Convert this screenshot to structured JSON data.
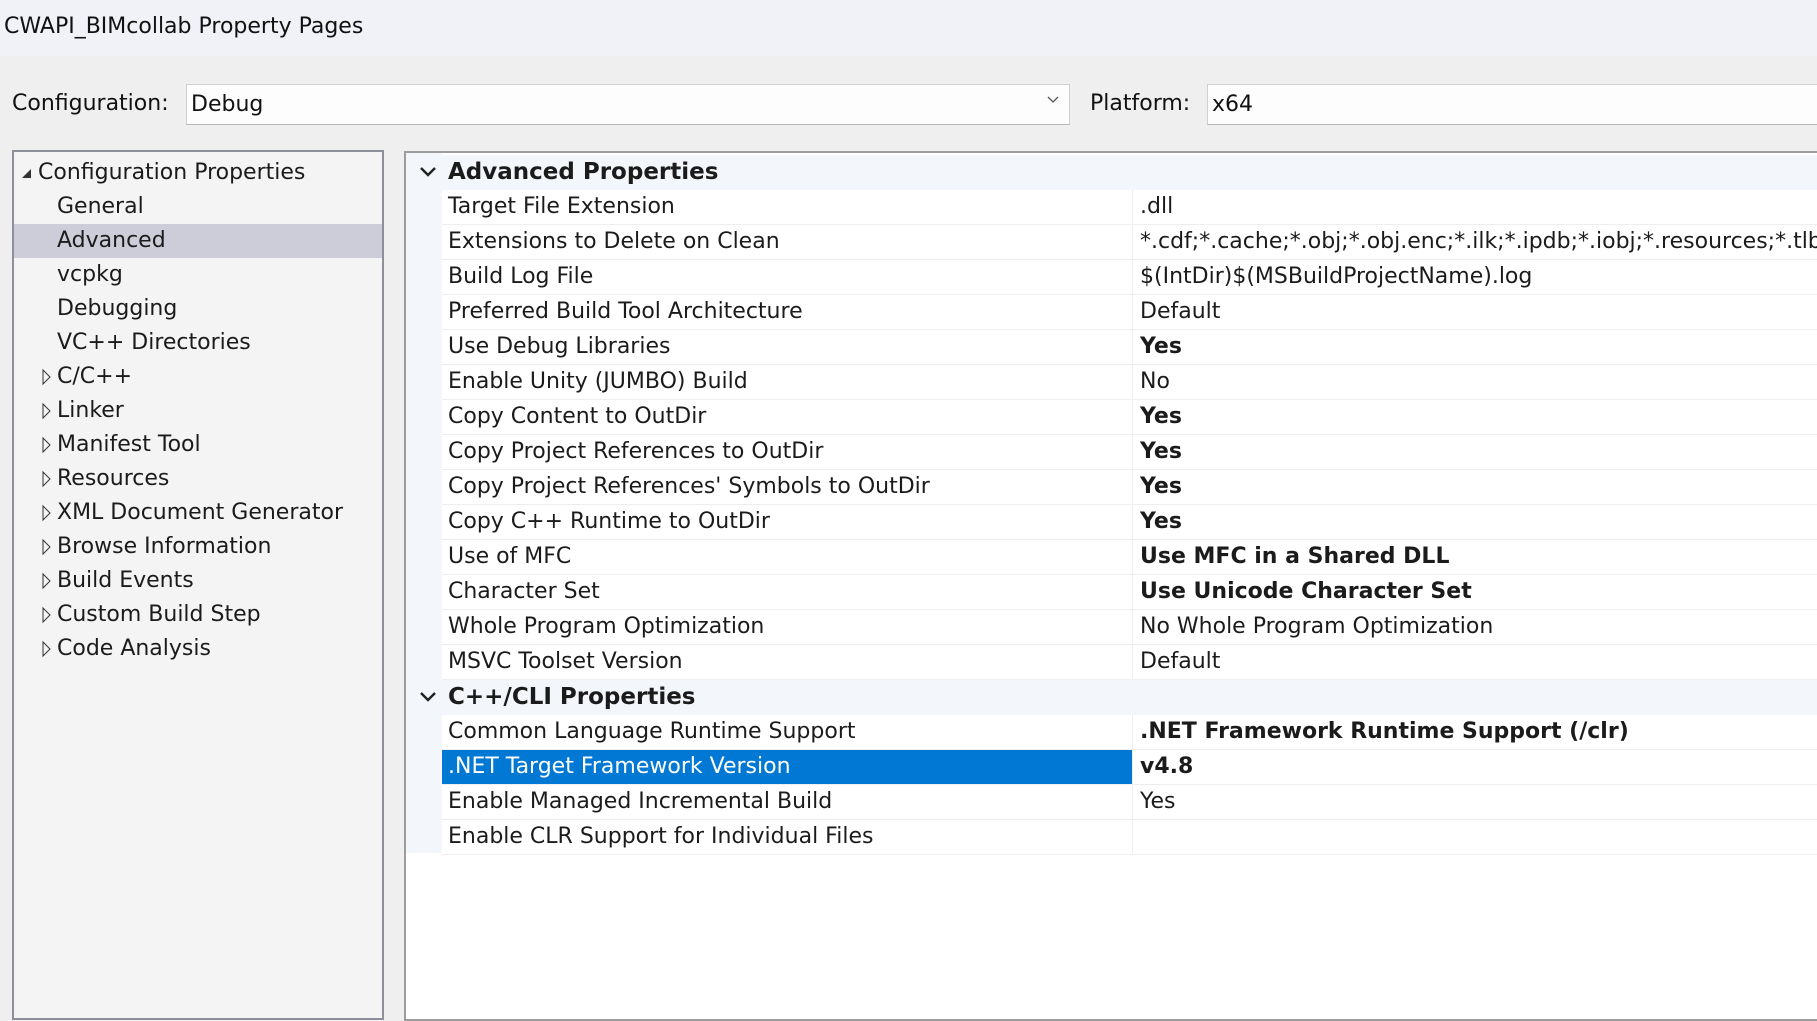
{
  "window": {
    "title": "CWAPI_BIMcollab Property Pages"
  },
  "config_bar": {
    "configuration_label": "Configuration:",
    "configuration_value": "Debug",
    "platform_label": "Platform:",
    "platform_value": "x64"
  },
  "tree": {
    "root": {
      "label": "Configuration Properties",
      "expanded": true
    },
    "items": [
      {
        "label": "General",
        "expandable": false,
        "selected": false
      },
      {
        "label": "Advanced",
        "expandable": false,
        "selected": true
      },
      {
        "label": "vcpkg",
        "expandable": false,
        "selected": false
      },
      {
        "label": "Debugging",
        "expandable": false,
        "selected": false
      },
      {
        "label": "VC++ Directories",
        "expandable": false,
        "selected": false
      },
      {
        "label": "C/C++",
        "expandable": true,
        "selected": false
      },
      {
        "label": "Linker",
        "expandable": true,
        "selected": false
      },
      {
        "label": "Manifest Tool",
        "expandable": true,
        "selected": false
      },
      {
        "label": "Resources",
        "expandable": true,
        "selected": false
      },
      {
        "label": "XML Document Generator",
        "expandable": true,
        "selected": false
      },
      {
        "label": "Browse Information",
        "expandable": true,
        "selected": false
      },
      {
        "label": "Build Events",
        "expandable": true,
        "selected": false
      },
      {
        "label": "Custom Build Step",
        "expandable": true,
        "selected": false
      },
      {
        "label": "Code Analysis",
        "expandable": true,
        "selected": false
      }
    ]
  },
  "property_grid": {
    "groups": [
      {
        "title": "Advanced Properties",
        "expanded": true,
        "properties": [
          {
            "name": "Target File Extension",
            "value": ".dll",
            "bold": false
          },
          {
            "name": "Extensions to Delete on Clean",
            "value": "*.cdf;*.cache;*.obj;*.obj.enc;*.ilk;*.ipdb;*.iobj;*.resources;*.tlb;*.tli;*.",
            "bold": false
          },
          {
            "name": "Build Log File",
            "value": "$(IntDir)$(MSBuildProjectName).log",
            "bold": false
          },
          {
            "name": "Preferred Build Tool Architecture",
            "value": "Default",
            "bold": false
          },
          {
            "name": "Use Debug Libraries",
            "value": "Yes",
            "bold": true
          },
          {
            "name": "Enable Unity (JUMBO) Build",
            "value": "No",
            "bold": false
          },
          {
            "name": "Copy Content to OutDir",
            "value": "Yes",
            "bold": true
          },
          {
            "name": "Copy Project References to OutDir",
            "value": "Yes",
            "bold": true
          },
          {
            "name": "Copy Project References' Symbols to OutDir",
            "value": "Yes",
            "bold": true
          },
          {
            "name": "Copy C++ Runtime to OutDir",
            "value": "Yes",
            "bold": true
          },
          {
            "name": "Use of MFC",
            "value": "Use MFC in a Shared DLL",
            "bold": true
          },
          {
            "name": "Character Set",
            "value": "Use Unicode Character Set",
            "bold": true
          },
          {
            "name": "Whole Program Optimization",
            "value": "No Whole Program Optimization",
            "bold": false
          },
          {
            "name": "MSVC Toolset Version",
            "value": "Default",
            "bold": false
          }
        ]
      },
      {
        "title": "C++/CLI Properties",
        "expanded": true,
        "properties": [
          {
            "name": "Common Language Runtime Support",
            "value": ".NET Framework Runtime Support (/clr)",
            "bold": true
          },
          {
            "name": ".NET Target Framework Version",
            "value": "v4.8",
            "bold": true,
            "selected": true
          },
          {
            "name": "Enable Managed Incremental Build",
            "value": "Yes",
            "bold": false
          },
          {
            "name": "Enable CLR Support for Individual Files",
            "value": "",
            "bold": false
          }
        ]
      }
    ]
  },
  "colors": {
    "selection": "#0078d4",
    "tree_selection": "#cdcdda"
  }
}
